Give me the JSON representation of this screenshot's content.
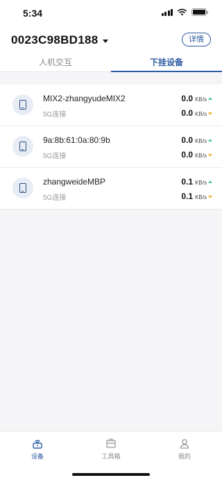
{
  "status_bar": {
    "time": "5:34"
  },
  "header": {
    "device_id": "0023C98BD188",
    "detail_label": "详情"
  },
  "tabs": [
    {
      "label": "人机交互",
      "active": false
    },
    {
      "label": "下挂设备",
      "active": true
    }
  ],
  "devices": [
    {
      "name": "MIX2-zhangyudeMIX2",
      "connection": "5G连接",
      "up_value": "0.0",
      "up_unit": "KB/s",
      "down_value": "0.0",
      "down_unit": "KB/s"
    },
    {
      "name": "9a:8b:61:0a:80:9b",
      "connection": "5G连接",
      "up_value": "0.0",
      "up_unit": "KB/s",
      "down_value": "0.0",
      "down_unit": "KB/s"
    },
    {
      "name": "zhangweideMBP",
      "connection": "5G连接",
      "up_value": "0.1",
      "up_unit": "KB/s",
      "down_value": "0.1",
      "down_unit": "KB/s"
    }
  ],
  "tabbar": [
    {
      "label": "设备",
      "icon": "router-icon",
      "active": true
    },
    {
      "label": "工具箱",
      "icon": "toolbox-icon",
      "active": false
    },
    {
      "label": "我的",
      "icon": "profile-icon",
      "active": false
    }
  ],
  "colors": {
    "accent": "#2c5aa0",
    "up_arrow": "#4fc3a1",
    "down_arrow": "#f3b23a"
  }
}
